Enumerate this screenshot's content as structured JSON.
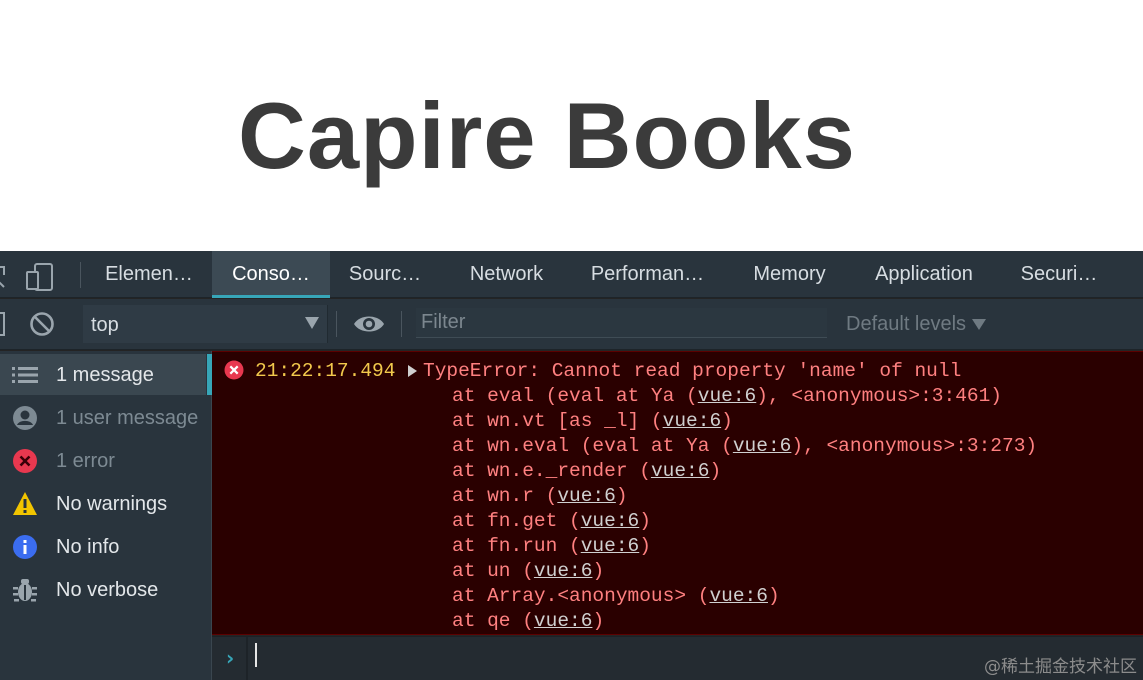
{
  "page": {
    "title": "Capire Books"
  },
  "devtools": {
    "tabs": [
      {
        "label": "Elemen…",
        "active": false
      },
      {
        "label": "Conso…",
        "active": true
      },
      {
        "label": "Sourc…",
        "active": false
      },
      {
        "label": "Network",
        "active": false
      },
      {
        "label": "Performan…",
        "active": false
      },
      {
        "label": "Memory",
        "active": false
      },
      {
        "label": "Application",
        "active": false
      },
      {
        "label": "Securi…",
        "active": false
      }
    ],
    "toolbar": {
      "context": "top",
      "filter_placeholder": "Filter",
      "levels": "Default levels"
    },
    "sidebar": {
      "items": [
        {
          "label": "1 message",
          "icon": "list-icon"
        },
        {
          "label": "1 user message",
          "icon": "user-icon"
        },
        {
          "label": "1 error",
          "icon": "error-icon"
        },
        {
          "label": "No warnings",
          "icon": "warning-icon"
        },
        {
          "label": "No info",
          "icon": "info-icon"
        },
        {
          "label": "No verbose",
          "icon": "bug-icon"
        }
      ]
    },
    "console": {
      "timestamp": "21:22:17.494",
      "message": "TypeError: Cannot read property 'name' of null",
      "stack": [
        {
          "pre": "at eval (eval at Ya (",
          "src": "vue:6",
          "post": "), <anonymous>:3:461)"
        },
        {
          "pre": "at wn.vt [as _l] (",
          "src": "vue:6",
          "post": ")"
        },
        {
          "pre": "at wn.eval (eval at Ya (",
          "src": "vue:6",
          "post": "), <anonymous>:3:273)"
        },
        {
          "pre": "at wn.e._render (",
          "src": "vue:6",
          "post": ")"
        },
        {
          "pre": "at wn.r (",
          "src": "vue:6",
          "post": ")"
        },
        {
          "pre": "at fn.get (",
          "src": "vue:6",
          "post": ")"
        },
        {
          "pre": "at fn.run (",
          "src": "vue:6",
          "post": ")"
        },
        {
          "pre": "at un (",
          "src": "vue:6",
          "post": ")"
        },
        {
          "pre": "at Array.<anonymous> (",
          "src": "vue:6",
          "post": ")"
        },
        {
          "pre": "at qe (",
          "src": "vue:6",
          "post": ")"
        }
      ],
      "watermark": "@稀土掘金技术社区"
    }
  },
  "colors": {
    "error_text": "#ff8080",
    "timestamp": "#f2c94c",
    "accent": "#37a6b8",
    "error_bg": "#2a0000"
  }
}
